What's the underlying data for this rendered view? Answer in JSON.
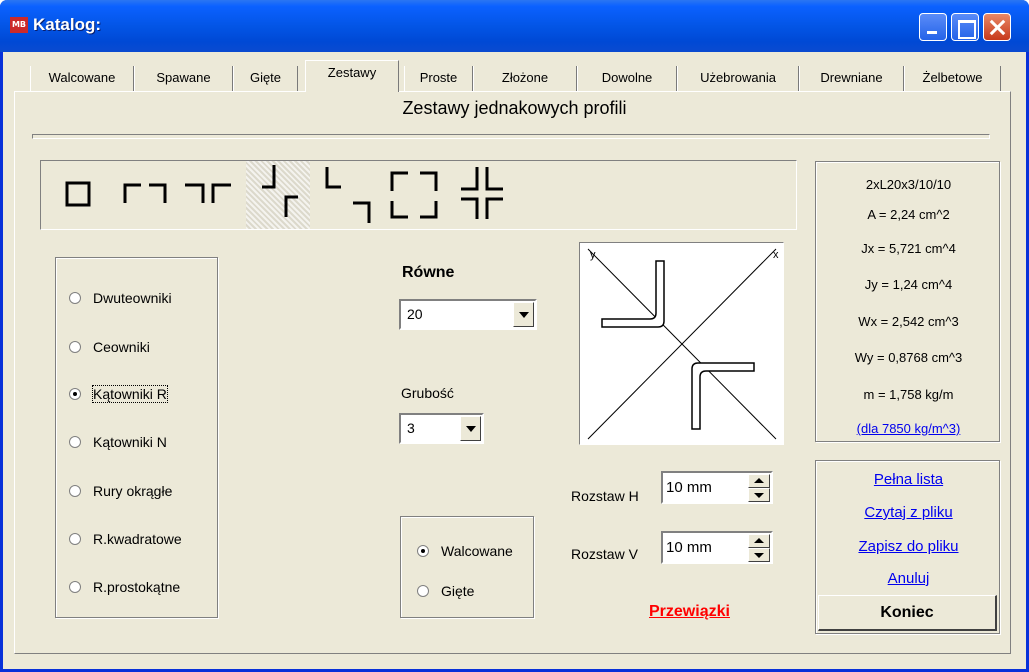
{
  "window": {
    "title": "Katalog:",
    "app_icon": "catalog-app-icon"
  },
  "tabs": [
    {
      "label": "Walcowane"
    },
    {
      "label": "Spawane"
    },
    {
      "label": "Gięte"
    },
    {
      "label": "Zestawy"
    },
    {
      "label": "Proste"
    },
    {
      "label": "Złożone"
    },
    {
      "label": "Dowolne"
    },
    {
      "label": "Użebrowania"
    },
    {
      "label": "Drewniane"
    },
    {
      "label": "Żelbetowe"
    }
  ],
  "active_tab": "Zestawy",
  "heading": "Zestawy jednakowych profili",
  "profile_types": [
    {
      "label": "Dwuteowniki",
      "checked": false
    },
    {
      "label": "Ceowniki",
      "checked": false
    },
    {
      "label": "Kątowniki R",
      "checked": true
    },
    {
      "label": "Kątowniki N",
      "checked": false
    },
    {
      "label": "Rury okrągłe",
      "checked": false
    },
    {
      "label": "R.kwadratowe",
      "checked": false
    },
    {
      "label": "R.prostokątne",
      "checked": false
    }
  ],
  "arrangement_icons": [
    "box-section-icon",
    "channels-face-to-face-icon",
    "channels-back-to-back-icon",
    "angles-diagonal-icon",
    "angles-offset-icon",
    "angles-box-icon",
    "angles-cross-icon"
  ],
  "selected_arrangement_index": 3,
  "size": {
    "label": "Równe",
    "value": "20"
  },
  "thickness": {
    "label": "Grubość",
    "value": "3"
  },
  "forming": [
    {
      "label": "Walcowane",
      "checked": true
    },
    {
      "label": "Gięte",
      "checked": false
    }
  ],
  "preview": {
    "axis_y": "y",
    "axis_x": "x"
  },
  "spacing": {
    "h_label": "Rozstaw H",
    "h_value": "10 mm",
    "v_label": "Rozstaw V",
    "v_value": "10 mm"
  },
  "przewiazki": "Przewiązki",
  "properties": {
    "name": "2xL20x3/10/10",
    "A": "A = 2,24 cm^2",
    "Jx": "Jx = 5,721 cm^4",
    "Jy": "Jy = 1,24 cm^4",
    "Wx": "Wx = 2,542 cm^3",
    "Wy": "Wy = 0,8768 cm^3",
    "m": "m = 1,758 kg/m",
    "density_link": "(dla 7850 kg/m^3)"
  },
  "actions": {
    "full_list": "Pełna lista",
    "read_file": "Czytaj z pliku",
    "save_file": "Zapisz do pliku",
    "cancel": "Anuluj",
    "close": "Koniec"
  },
  "colors": {
    "window_bg": "#ece9d8",
    "title_bar": "#0355e6",
    "link": "#0000ee",
    "przewiazki": "#ff0000"
  }
}
